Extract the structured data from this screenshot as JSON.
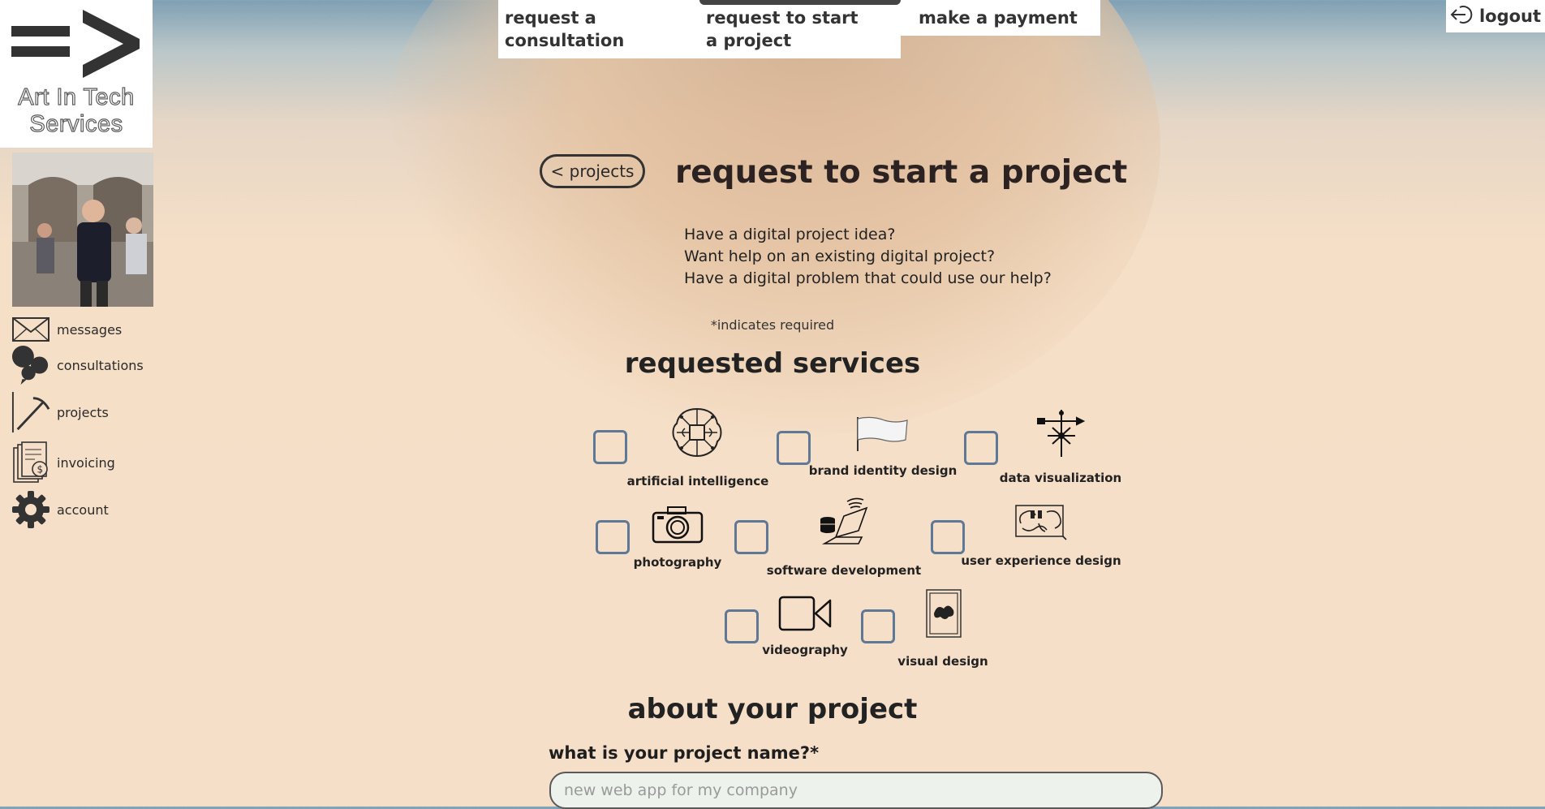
{
  "brand": {
    "line1": "Art In Tech",
    "line2": "Services"
  },
  "top_nav": {
    "tabs": [
      {
        "label": "request a consultation",
        "active": false
      },
      {
        "label": "request to start a project",
        "active": true
      },
      {
        "label": "make a payment",
        "active": false
      }
    ],
    "logout_label": "logout"
  },
  "sidebar": {
    "items": [
      {
        "label": "messages",
        "icon": "envelope-icon"
      },
      {
        "label": "consultations",
        "icon": "speech-bubbles-icon"
      },
      {
        "label": "projects",
        "icon": "pickaxe-icon"
      },
      {
        "label": "invoicing",
        "icon": "invoice-icon"
      },
      {
        "label": "account",
        "icon": "gear-icon"
      }
    ]
  },
  "main": {
    "back_label": "< projects",
    "title": "request to start a project",
    "intro_lines": [
      "Have a digital project idea?",
      "Want help on an existing digital project?",
      "Have a digital problem that could use our help?"
    ],
    "required_note": "*indicates required",
    "services_title": "requested services",
    "services": [
      {
        "label": "artificial intelligence",
        "icon": "brain-circuit-icon",
        "checked": false
      },
      {
        "label": "brand identity design",
        "icon": "flag-icon",
        "checked": false
      },
      {
        "label": "data visualization",
        "icon": "weather-vane-icon",
        "checked": false
      },
      {
        "label": "photography",
        "icon": "camera-icon",
        "checked": false
      },
      {
        "label": "software development",
        "icon": "laptop-database-icon",
        "checked": false
      },
      {
        "label": "user experience design",
        "icon": "sketch-face-icon",
        "checked": false
      },
      {
        "label": "videography",
        "icon": "video-camera-icon",
        "checked": false
      },
      {
        "label": "visual design",
        "icon": "framed-art-icon",
        "checked": false
      }
    ],
    "about_title": "about your project",
    "project_name_label": "what is your project name?*",
    "project_name_placeholder": "new web app for my company",
    "project_name_value": ""
  },
  "colors": {
    "checkbox_border": "#5f7896",
    "background": "#f6dfc8",
    "sky": "#7fa0b4"
  }
}
